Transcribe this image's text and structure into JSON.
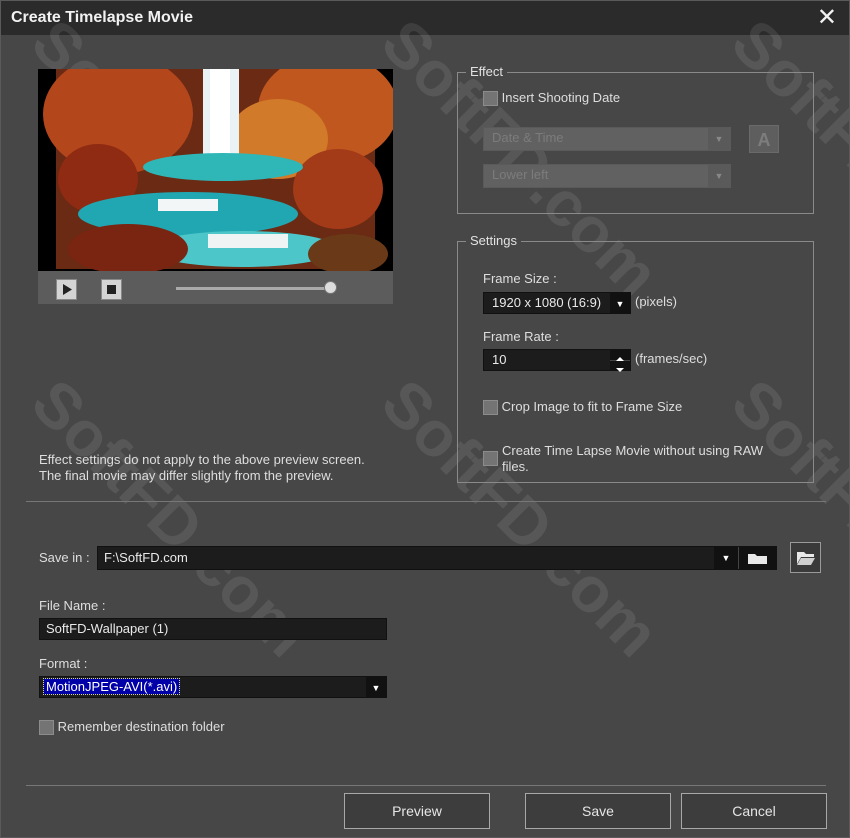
{
  "window": {
    "title": "Create Timelapse Movie",
    "close_glyph": "✕"
  },
  "watermark": "SoftFD.com",
  "preview_note": [
    "Effect settings do not apply to the above preview screen.",
    "The final movie may differ slightly from the preview."
  ],
  "effect": {
    "legend": "Effect",
    "insert_date_label": "Insert Shooting Date",
    "insert_date_checked": false,
    "date_format": "Date & Time",
    "position": "Lower left",
    "font_button_glyph": "A"
  },
  "settings": {
    "legend": "Settings",
    "frame_size_label": "Frame Size :",
    "frame_size": "1920 x 1080 (16:9)",
    "frame_size_unit": "(pixels)",
    "frame_rate_label": "Frame Rate :",
    "frame_rate": "10",
    "frame_rate_unit": "(frames/sec)",
    "crop_label": "Crop Image to fit to Frame Size",
    "crop_checked": false,
    "raw_label_line1": "Create Time Lapse Movie without using RAW",
    "raw_label_line2": "files.",
    "raw_checked": false
  },
  "save_in": {
    "label": "Save in :",
    "path": "F:\\SoftFD.com"
  },
  "file_name": {
    "label": "File Name :",
    "value": "SoftFD-Wallpaper (1)"
  },
  "format": {
    "label": "Format :",
    "value": "MotionJPEG-AVI(*.avi)"
  },
  "remember": {
    "label": "Remember destination folder",
    "checked": false
  },
  "buttons": {
    "preview": "Preview",
    "save": "Save",
    "cancel": "Cancel"
  },
  "colors": {
    "window_bg": "#474747",
    "titlebar": "#2b2b2b",
    "field_bg": "#1c1c1c",
    "format_selected": "#0000a8"
  }
}
